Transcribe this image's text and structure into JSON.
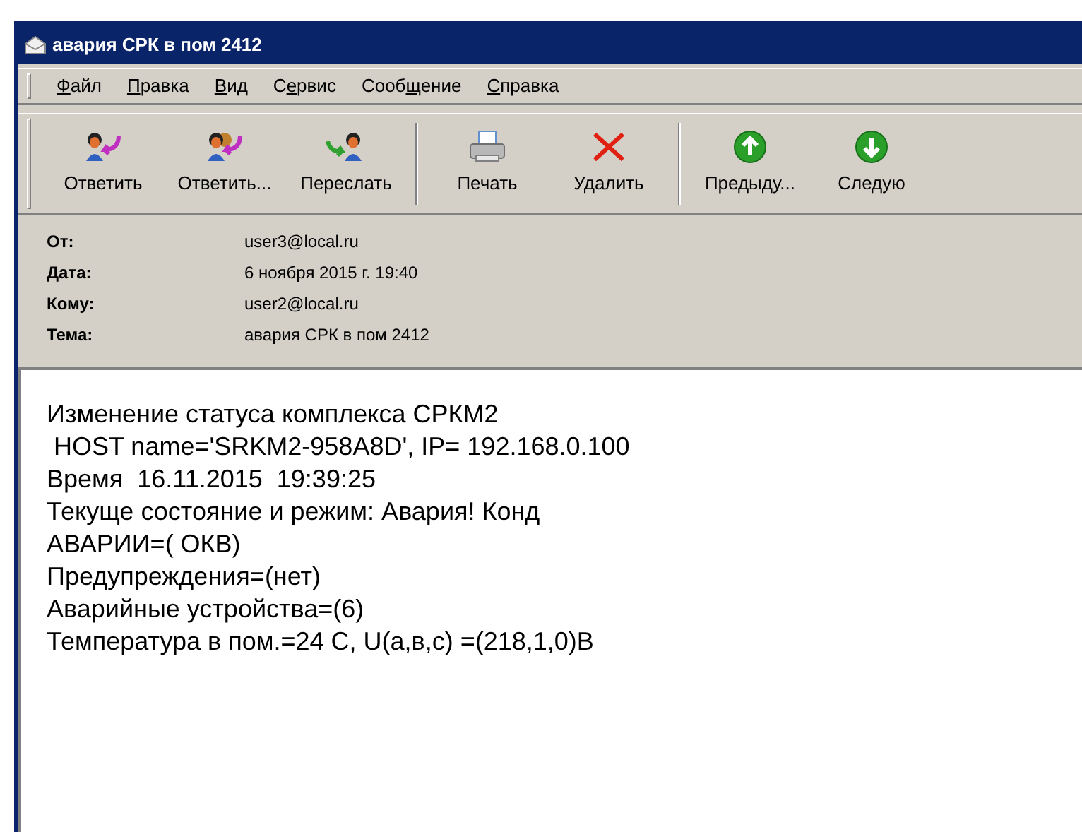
{
  "window": {
    "title": "авария СРК в пом 2412"
  },
  "menu": [
    {
      "key": "Ф",
      "after": "айл"
    },
    {
      "key": "П",
      "after": "равка"
    },
    {
      "key": "В",
      "after": "ид"
    },
    {
      "before": "С",
      "key": "е",
      "after": "рвис"
    },
    {
      "before": "Сооб",
      "key": "щ",
      "after": "ение"
    },
    {
      "key": "С",
      "after": "правка"
    }
  ],
  "toolbar": [
    {
      "kind": "reply",
      "label": "Ответить"
    },
    {
      "kind": "reply_all",
      "label": "Ответить..."
    },
    {
      "kind": "forward",
      "label": "Переслать"
    },
    {
      "kind": "separator"
    },
    {
      "kind": "print",
      "label": "Печать"
    },
    {
      "kind": "delete",
      "label": "Удалить"
    },
    {
      "kind": "separator"
    },
    {
      "kind": "previous",
      "label": "Предыду..."
    },
    {
      "kind": "next",
      "label": "Следую"
    }
  ],
  "header": [
    {
      "label": "От:",
      "value": "user3@local.ru"
    },
    {
      "label": "Дата:",
      "value": "6 ноября 2015 г. 19:40"
    },
    {
      "label": "Кому:",
      "value": "user2@local.ru"
    },
    {
      "label": "Тема:",
      "value": "авария СРК в пом 2412"
    }
  ],
  "body": [
    "Изменение статуса комплекса СРКМ2",
    " HOST name='SRKM2-958A8D', IP= 192.168.0.100",
    "Время  16.11.2015  19:39:25",
    "Текуще состояние и режим: Авария! Конд",
    "АВАРИИ=( ОКВ)",
    "Предупреждения=(нет)",
    "Аварийные устройства=(6)",
    "Температура в пом.=24 С, U(а,в,с) =(218,1,0)В"
  ]
}
